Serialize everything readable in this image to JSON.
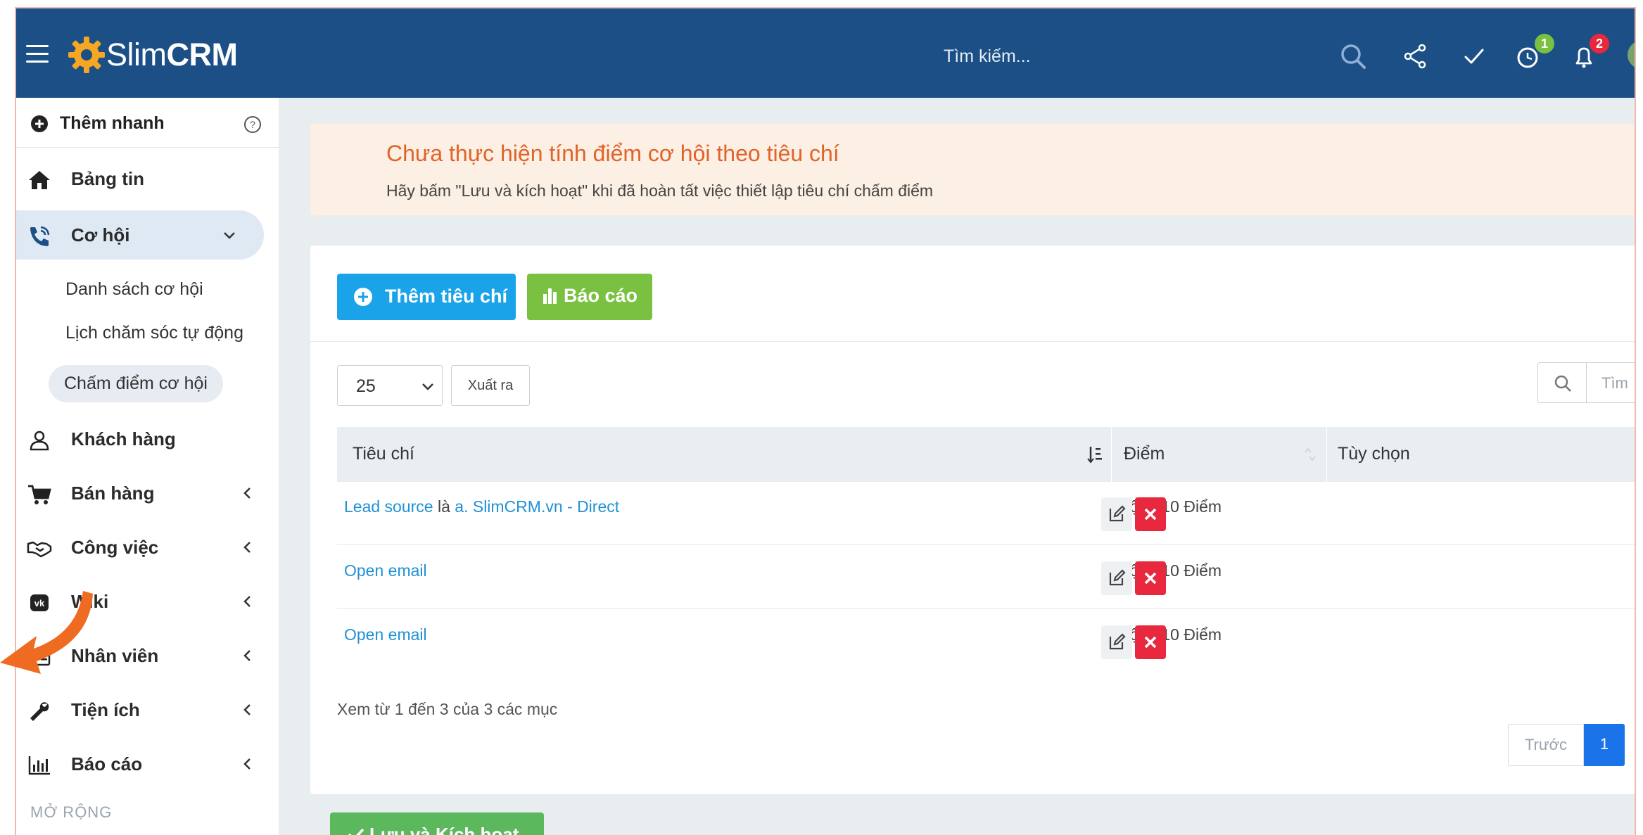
{
  "app": {
    "brand_prefix": "Slim",
    "brand_bold": "CRM",
    "search_placeholder": "Tìm kiếm...",
    "timer_badge": "1",
    "bell_badge": "2"
  },
  "colors": {
    "topbar": "#1b4f86",
    "primary": "#1aa3e8",
    "success": "#7ac142",
    "danger": "#e8283e",
    "alert_title": "#e0632b",
    "link": "#2191d6"
  },
  "sidebar": {
    "quick_add": "Thêm nhanh",
    "items": [
      {
        "label": "Bảng tin",
        "icon": "home-icon"
      },
      {
        "label": "Cơ hội",
        "icon": "phone-icon"
      },
      {
        "label": "Khách hàng",
        "icon": "user-icon"
      },
      {
        "label": "Bán hàng",
        "icon": "cart-icon"
      },
      {
        "label": "Công việc",
        "icon": "handshake-icon"
      },
      {
        "label": "Wiki",
        "icon": "vk-icon"
      },
      {
        "label": "Nhân viên",
        "icon": "id-card-icon"
      },
      {
        "label": "Tiện ích",
        "icon": "wrench-icon"
      },
      {
        "label": "Báo cáo",
        "icon": "bar-chart-icon"
      }
    ],
    "sub_items": [
      "Danh sách cơ hội",
      "Lịch chăm sóc tự động",
      "Chấm điểm cơ hội"
    ],
    "section_label": "MỞ RỘNG"
  },
  "alert": {
    "title": "Chưa thực hiện tính điểm cơ hội theo tiêu chí",
    "desc": "Hãy bấm \"Lưu và kích hoạt\" khi đã hoàn tất việc thiết lập tiêu chí chấm điểm"
  },
  "toolbar": {
    "add_label": "Thêm tiêu chí",
    "report_label": "Báo cáo",
    "page_size": "25",
    "export_label": "Xuất ra",
    "search_placeholder": "Tìm"
  },
  "table": {
    "headers": [
      "Tiêu chí",
      "Điểm",
      "Tùy chọn"
    ],
    "rows": [
      {
        "c1": "Lead source",
        "c_mid": " là ",
        "c2": "a. SlimCRM.vn - Direct",
        "score": "Cộng 10 Điểm"
      },
      {
        "c1": "Open email",
        "score": "Cộng 10 Điểm"
      },
      {
        "c1": "Open email",
        "score": "Cộng 10 Điểm"
      }
    ]
  },
  "footer": {
    "info": "Xem từ 1 đến 3 của 3 các mục",
    "prev": "Trước",
    "page": "1",
    "save_label": "Lưu và Kích hoạt"
  }
}
